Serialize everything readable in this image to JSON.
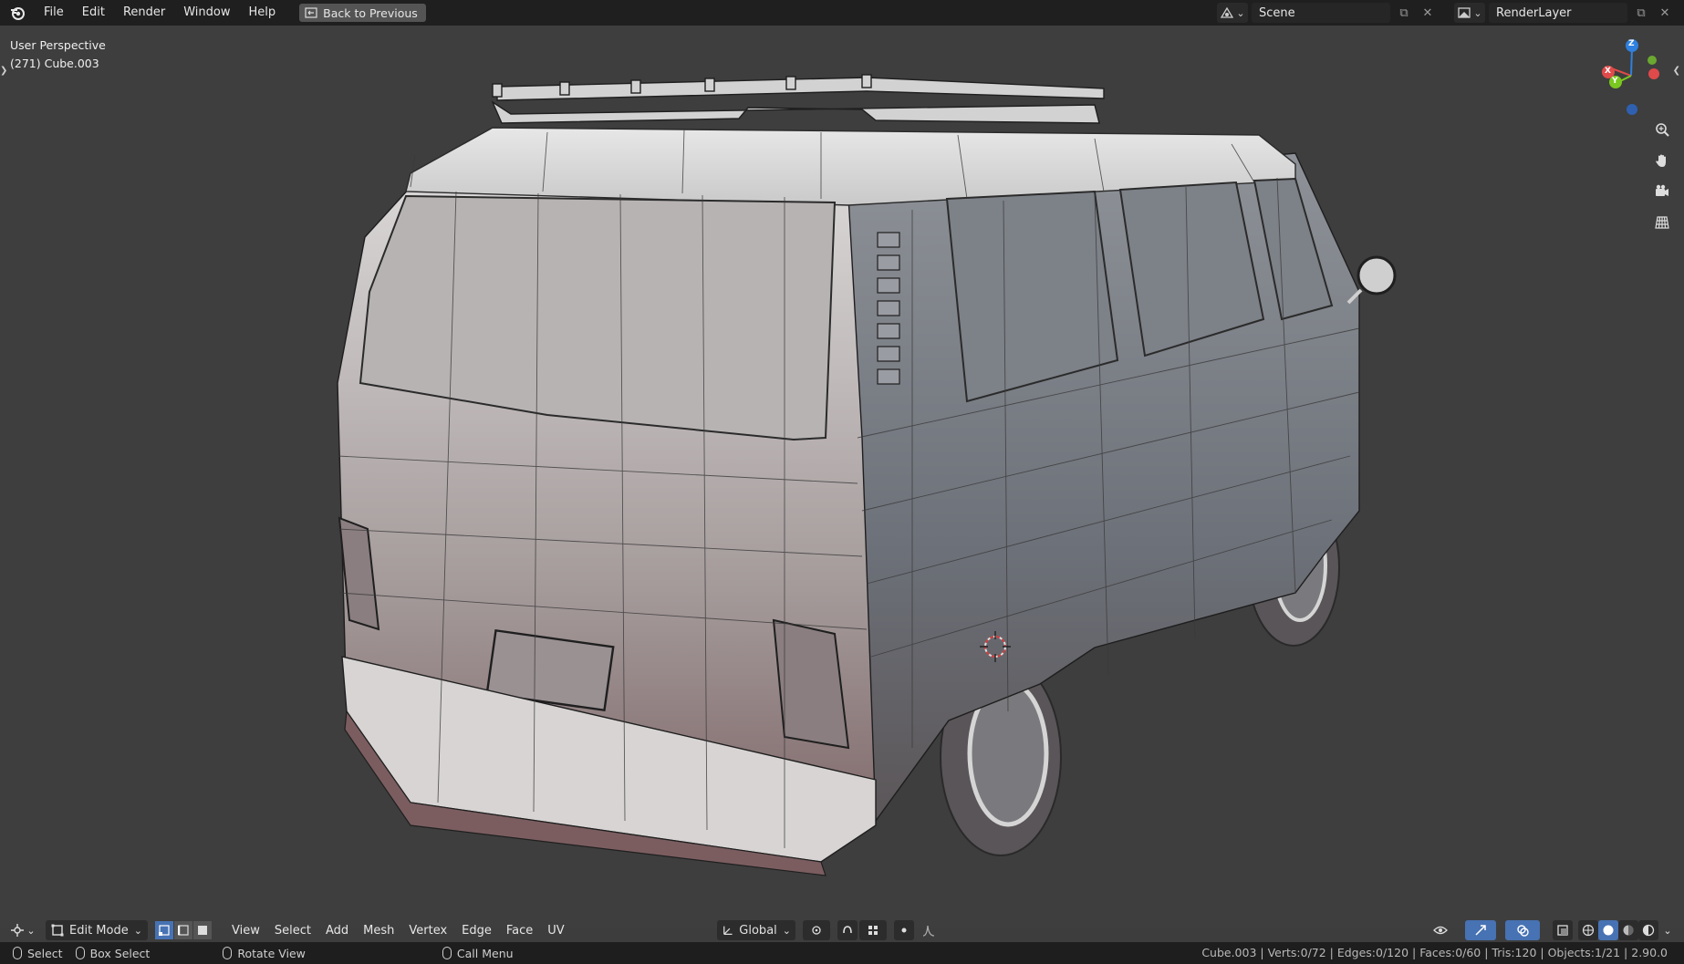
{
  "menu": {
    "items": [
      "File",
      "Edit",
      "Render",
      "Window",
      "Help"
    ],
    "back_button": "Back to Previous"
  },
  "scene": {
    "name": "Scene"
  },
  "view_layer": {
    "name": "RenderLayer"
  },
  "viewport": {
    "perspective_label": "User Perspective",
    "object_label": "(271) Cube.003",
    "gizmo": {
      "x": "X",
      "y": "Y",
      "z": "Z"
    }
  },
  "header": {
    "mode": "Edit Mode",
    "menus": [
      "View",
      "Select",
      "Add",
      "Mesh",
      "Vertex",
      "Edge",
      "Face",
      "UV"
    ],
    "orientation": "Global"
  },
  "status": {
    "select": "Select",
    "box_select": "Box Select",
    "rotate_view": "Rotate View",
    "call_menu": "Call Menu",
    "stats": "Cube.003 | Verts:0/72 | Edges:0/120 | Faces:0/60 | Tris:120 | Objects:1/21 | 2.90.0"
  },
  "colors": {
    "accent": "#4772b3",
    "background": "#3e3e3e",
    "topbar": "#1f1f1f",
    "axis_x": "#e04a4a",
    "axis_y": "#7ac81f",
    "axis_z": "#2f80e0"
  }
}
